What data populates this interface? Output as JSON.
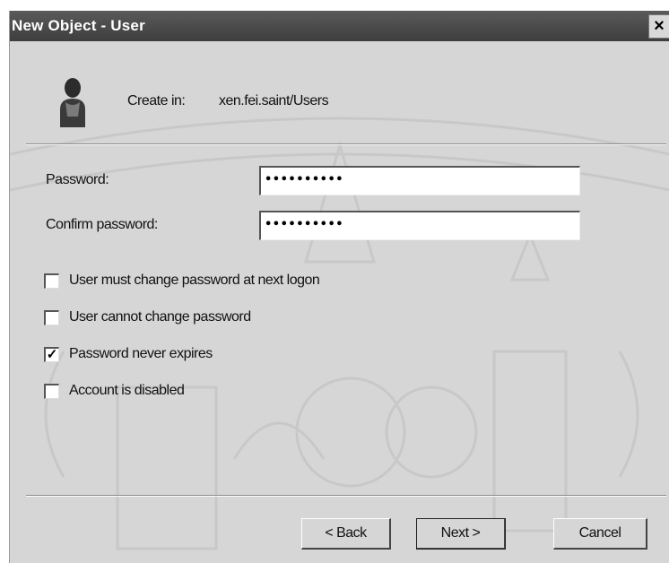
{
  "window": {
    "title": "New Object - User",
    "close_glyph": "×"
  },
  "header": {
    "create_label": "Create in:",
    "create_path": "xen.fei.saint/Users",
    "icon": "user-icon"
  },
  "fields": [
    {
      "label": "Password:",
      "masked_value": "••••••••••"
    },
    {
      "label": "Confirm password:",
      "masked_value": "••••••••••"
    }
  ],
  "options": [
    {
      "label": "User must change password at next logon",
      "checked": false
    },
    {
      "label": "User cannot change password",
      "checked": false
    },
    {
      "label": "Password never expires",
      "checked": true
    },
    {
      "label": "Account is disabled",
      "checked": false
    }
  ],
  "buttons": {
    "back": "< Back",
    "next": "Next >",
    "cancel": "Cancel"
  }
}
